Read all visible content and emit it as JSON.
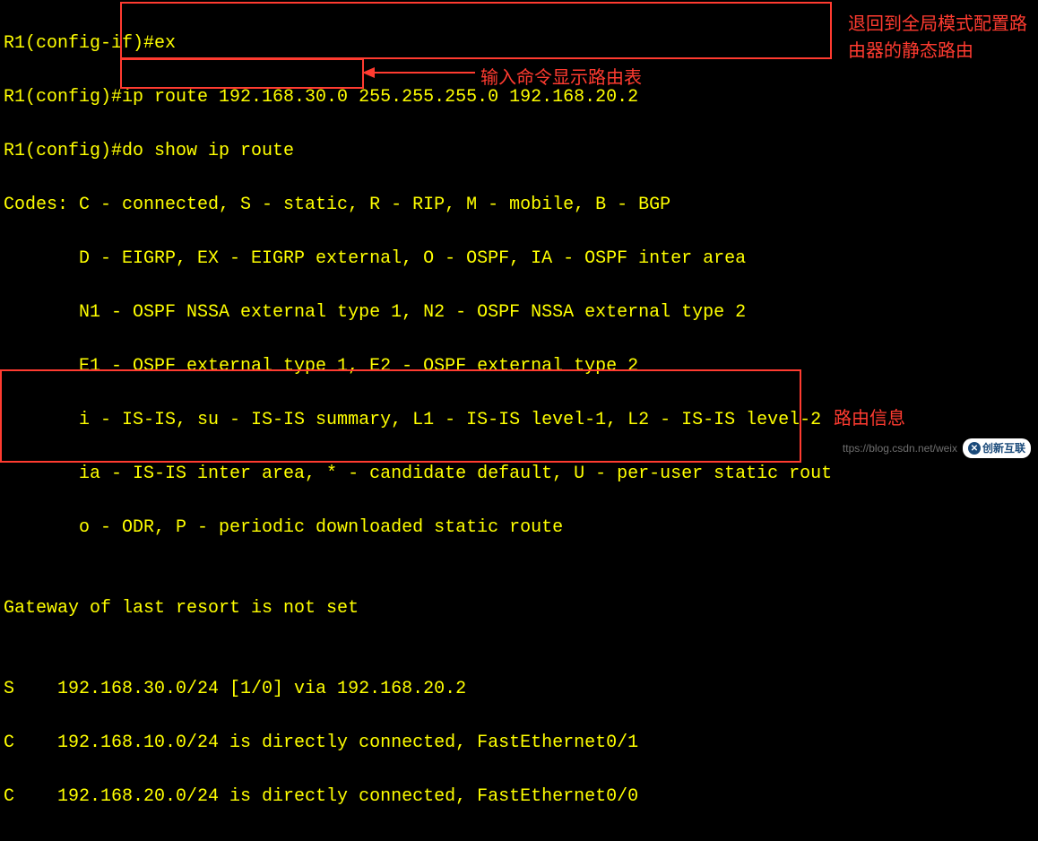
{
  "terminal": {
    "l1": "R1(config-if)#ex",
    "l2": "R1(config)#ip route 192.168.30.0 255.255.255.0 192.168.20.2",
    "l3": "R1(config)#do show ip route",
    "l4": "Codes: C - connected, S - static, R - RIP, M - mobile, B - BGP",
    "l5": "       D - EIGRP, EX - EIGRP external, O - OSPF, IA - OSPF inter area",
    "l6": "       N1 - OSPF NSSA external type 1, N2 - OSPF NSSA external type 2",
    "l7": "       E1 - OSPF external type 1, E2 - OSPF external type 2",
    "l8": "       i - IS-IS, su - IS-IS summary, L1 - IS-IS level-1, L2 - IS-IS level-2",
    "l9": "       ia - IS-IS inter area, * - candidate default, U - per-user static rout",
    "l10": "       o - ODR, P - periodic downloaded static route",
    "l11": "",
    "l12": "Gateway of last resort is not set",
    "l13": "",
    "l14": "S    192.168.30.0/24 [1/0] via 192.168.20.2",
    "l15": "C    192.168.10.0/24 is directly connected, FastEthernet0/1",
    "l16": "C    192.168.20.0/24 is directly connected, FastEthernet0/0"
  },
  "annotations": {
    "showRoute": "输入命令显示路由表",
    "configStatic": "退回到全局模式配置路由器的静态路由",
    "routeInfo": "路由信息"
  },
  "watermark": {
    "url": "ttps://blog.csdn.net/weix",
    "logo": "创新互联"
  }
}
